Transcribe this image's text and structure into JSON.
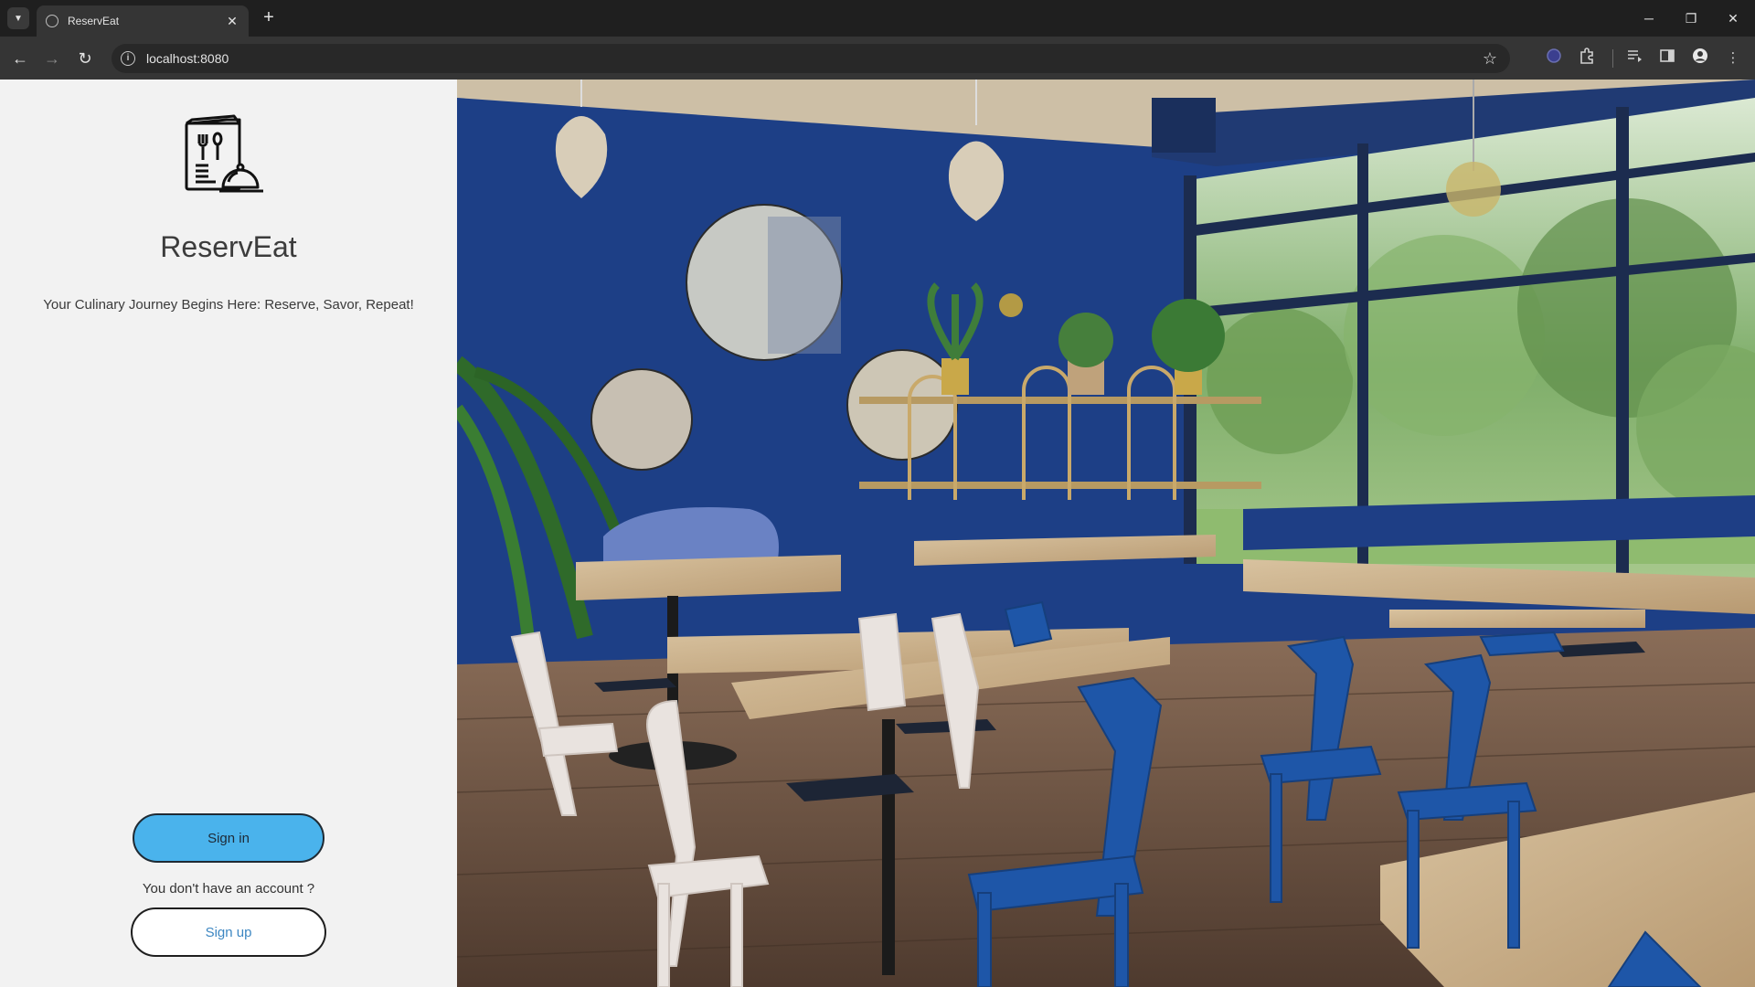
{
  "browser": {
    "tab_title": "ReservEat",
    "url": "localhost:8080",
    "new_tab_label": "+",
    "close_tab_label": "✕"
  },
  "app": {
    "brand_name": "ReservEat",
    "tagline": "Your Culinary Journey Begins Here: Reserve, Savor, Repeat!",
    "signin_label": "Sign in",
    "no_account_text": "You don't have an account ?",
    "signup_label": "Sign up"
  },
  "colors": {
    "accent": "#4ab3ec",
    "link": "#3d87c2",
    "wall_blue": "#1d3f86",
    "chair_blue": "#1e56a8"
  },
  "icons": {
    "logo": "menu-cloche-icon",
    "hero": "restaurant-interior-image"
  }
}
